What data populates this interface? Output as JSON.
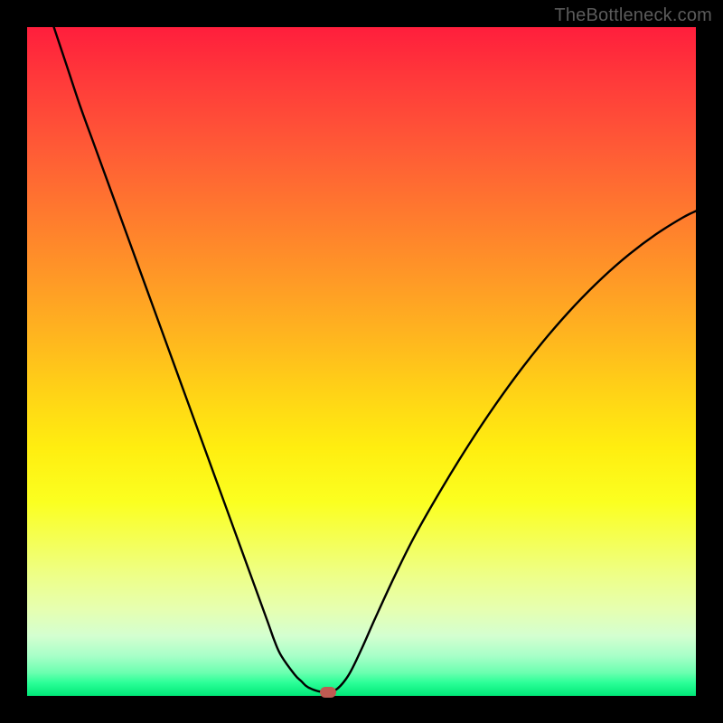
{
  "watermark": "TheBottleneck.com",
  "colors": {
    "curve_stroke": "#000000",
    "marker": "#c05a52",
    "frame": "#000000"
  },
  "chart_data": {
    "type": "line",
    "title": "",
    "xlabel": "",
    "ylabel": "",
    "xlim": [
      0,
      100
    ],
    "ylim": [
      0,
      100
    ],
    "grid": false,
    "legend": false,
    "background_gradient": [
      "#ff1e3c",
      "#ffee10",
      "#00e878"
    ],
    "series": [
      {
        "name": "bottleneck-curve",
        "x": [
          4,
          6,
          8,
          10,
          12,
          14,
          16,
          18,
          20,
          22,
          24,
          26,
          28,
          30,
          32,
          34,
          36,
          37,
          38,
          40,
          41,
          42,
          44,
          46,
          48,
          50,
          52,
          55,
          58,
          62,
          66,
          70,
          74,
          78,
          82,
          86,
          90,
          94,
          98,
          100
        ],
        "values": [
          100,
          94,
          88,
          82.5,
          77,
          71.5,
          66,
          60.5,
          55,
          49.5,
          44,
          38.5,
          33,
          27.5,
          22,
          16.5,
          11,
          8.2,
          6,
          3.2,
          2.2,
          1.3,
          0.6,
          0.8,
          3,
          7,
          11.5,
          18,
          24,
          31,
          37.5,
          43.5,
          49,
          54,
          58.5,
          62.5,
          66,
          69,
          71.5,
          72.5
        ]
      }
    ],
    "annotations": [
      {
        "type": "marker",
        "x": 45,
        "y": 0.5,
        "shape": "rounded-rect",
        "color": "#c05a52",
        "label": "optimal-point"
      }
    ]
  }
}
